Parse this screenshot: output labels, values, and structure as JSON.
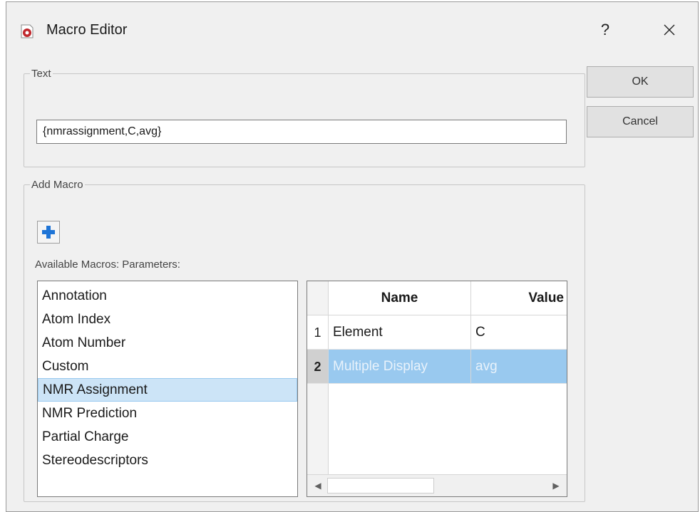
{
  "window": {
    "title": "Macro Editor",
    "help_label": "?",
    "icons": {
      "app": "app-logo-icon",
      "close": "close-icon"
    }
  },
  "text_group": {
    "legend": "Text",
    "value": "{nmrassignment,C,avg}"
  },
  "buttons": {
    "ok": "OK",
    "cancel": "Cancel"
  },
  "macro_group": {
    "legend": "Add Macro",
    "add_icon": "plus-icon",
    "labels": "Available Macros:  Parameters:",
    "macros": [
      "Annotation",
      "Atom Index",
      "Atom Number",
      "Custom",
      "NMR Assignment",
      "NMR Prediction",
      "Partial Charge",
      "Stereodescriptors"
    ],
    "selected_macro": "NMR Assignment",
    "parameters": {
      "columns": [
        "Name",
        "Value"
      ],
      "rows": [
        {
          "index": "1",
          "name": "Element",
          "value": "C"
        },
        {
          "index": "2",
          "name": "Multiple Display",
          "value": "avg"
        }
      ],
      "selected_row": "2"
    }
  },
  "colors": {
    "selection": "#99c9ef",
    "list_selection": "#cce4f7",
    "add_icon": "#1e74d6",
    "app_icon": "#c0282d"
  }
}
